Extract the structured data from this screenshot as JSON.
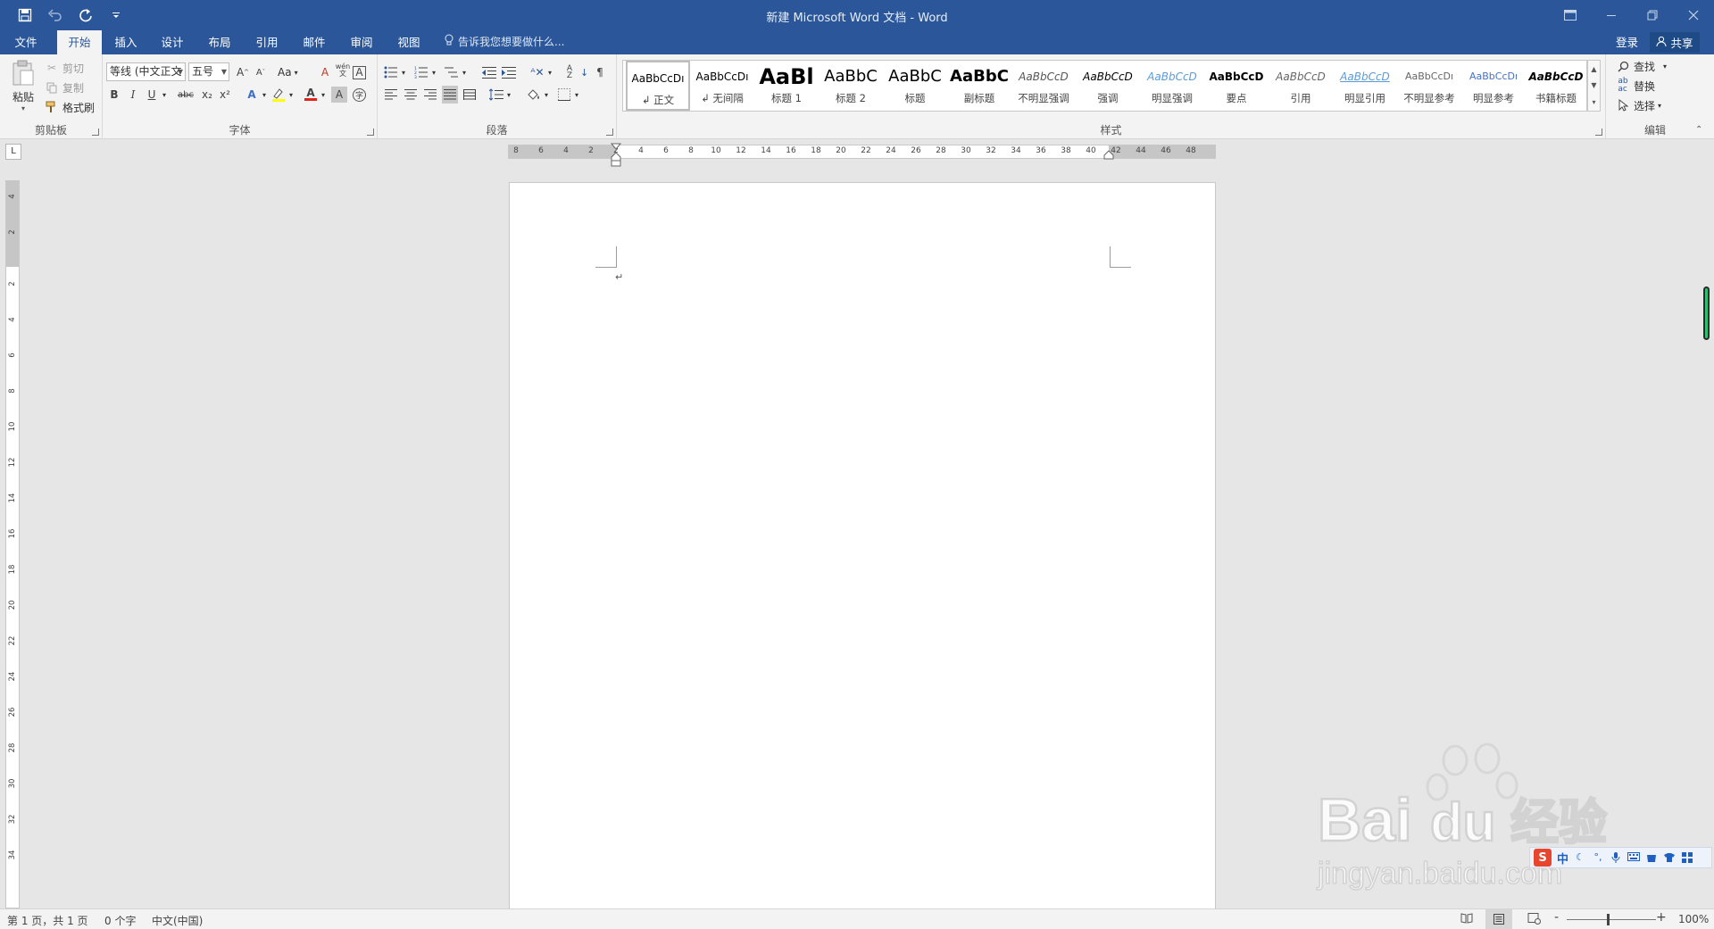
{
  "titlebar": {
    "title": "新建 Microsoft Word 文档 - Word",
    "quick_access": [
      "save-icon",
      "undo-icon",
      "redo-icon",
      "customize-icon"
    ]
  },
  "tabs": [
    {
      "label": "文件"
    },
    {
      "label": "开始"
    },
    {
      "label": "插入"
    },
    {
      "label": "设计"
    },
    {
      "label": "布局"
    },
    {
      "label": "引用"
    },
    {
      "label": "邮件"
    },
    {
      "label": "审阅"
    },
    {
      "label": "视图"
    }
  ],
  "active_tab": "开始",
  "tell_me": "告诉我您想要做什么...",
  "account": {
    "login": "登录",
    "share": "共享"
  },
  "clipboard": {
    "paste": "粘贴",
    "cut": "剪切",
    "copy": "复制",
    "format_painter": "格式刷",
    "label": "剪贴板"
  },
  "font": {
    "family": "等线 (中文正文",
    "size": "五号",
    "label": "字体",
    "bold": "B",
    "italic": "I",
    "underline": "U",
    "strike": "abc",
    "sub": "x₂",
    "sup": "x²",
    "change_case": "Aa",
    "pinyin": "wén",
    "char_border": "A",
    "char_shading": "A"
  },
  "paragraph": {
    "label": "段落"
  },
  "styles": {
    "label": "样式",
    "items": [
      {
        "preview": "AaBbCcDı",
        "name": "↲ 正文"
      },
      {
        "preview": "AaBbCcDı",
        "name": "↲ 无间隔"
      },
      {
        "preview": "AaBl",
        "name": "标题 1"
      },
      {
        "preview": "AaBbC",
        "name": "标题 2"
      },
      {
        "preview": "AaBbC",
        "name": "标题"
      },
      {
        "preview": "AaBbC",
        "name": "副标题"
      },
      {
        "preview": "AaBbCcD",
        "name": "不明显强调"
      },
      {
        "preview": "AaBbCcD",
        "name": "强调"
      },
      {
        "preview": "AaBbCcD",
        "name": "明显强调"
      },
      {
        "preview": "AaBbCcD",
        "name": "要点"
      },
      {
        "preview": "AaBbCcD",
        "name": "引用"
      },
      {
        "preview": "AaBbCcD",
        "name": "明显引用"
      },
      {
        "preview": "AaBbCcDı",
        "name": "不明显参考"
      },
      {
        "preview": "AaBbCcDı",
        "name": "明显参考"
      },
      {
        "preview": "AaBbCcD",
        "name": "书籍标题"
      }
    ]
  },
  "editing": {
    "find": "查找",
    "replace": "替换",
    "select": "选择",
    "label": "编辑"
  },
  "ruler": {
    "corner": "L",
    "h_labels": [
      "8",
      "6",
      "4",
      "2",
      "2",
      "4",
      "6",
      "8",
      "10",
      "12",
      "14",
      "16",
      "18",
      "20",
      "22",
      "24",
      "26",
      "28",
      "30",
      "32",
      "34",
      "36",
      "38",
      "40",
      "42",
      "44",
      "46",
      "48"
    ],
    "v_labels": [
      "4",
      "2",
      "2",
      "4",
      "6",
      "8",
      "10",
      "12",
      "14",
      "16",
      "18",
      "20",
      "22",
      "24",
      "26",
      "28",
      "30",
      "32",
      "34"
    ]
  },
  "page": {
    "paragraph_mark": "↵"
  },
  "ime": {
    "lang": "中",
    "mode_icons": [
      "moon-icon",
      "punctuation-icon",
      "mic-icon",
      "keyboard-icon",
      "skin-icon",
      "shirt-icon",
      "grid-icon"
    ]
  },
  "watermark": {
    "brand": "Bai",
    "brand2": "du",
    "cn": "经验",
    "url": "jingyan.baidu.com"
  },
  "statusbar": {
    "page": "第 1 页，共 1 页",
    "words": "0 个字",
    "language": "中文(中国)",
    "zoom": "100%",
    "zoom_minus": "-",
    "zoom_plus": "+"
  },
  "colors": {
    "brand": "#2b579a",
    "highlight": "#ffff00",
    "font_color": "#e2231a"
  }
}
